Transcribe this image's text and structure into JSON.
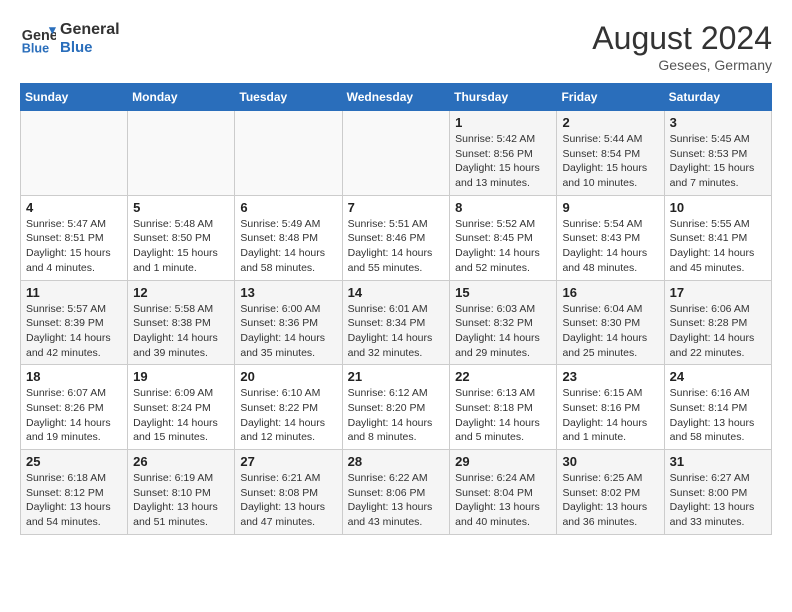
{
  "header": {
    "logo_line1": "General",
    "logo_line2": "Blue",
    "month": "August 2024",
    "location": "Gesees, Germany"
  },
  "days_of_week": [
    "Sunday",
    "Monday",
    "Tuesday",
    "Wednesday",
    "Thursday",
    "Friday",
    "Saturday"
  ],
  "weeks": [
    [
      {
        "day": "",
        "info": ""
      },
      {
        "day": "",
        "info": ""
      },
      {
        "day": "",
        "info": ""
      },
      {
        "day": "",
        "info": ""
      },
      {
        "day": "1",
        "info": "Sunrise: 5:42 AM\nSunset: 8:56 PM\nDaylight: 15 hours and 13 minutes."
      },
      {
        "day": "2",
        "info": "Sunrise: 5:44 AM\nSunset: 8:54 PM\nDaylight: 15 hours and 10 minutes."
      },
      {
        "day": "3",
        "info": "Sunrise: 5:45 AM\nSunset: 8:53 PM\nDaylight: 15 hours and 7 minutes."
      }
    ],
    [
      {
        "day": "4",
        "info": "Sunrise: 5:47 AM\nSunset: 8:51 PM\nDaylight: 15 hours and 4 minutes."
      },
      {
        "day": "5",
        "info": "Sunrise: 5:48 AM\nSunset: 8:50 PM\nDaylight: 15 hours and 1 minute."
      },
      {
        "day": "6",
        "info": "Sunrise: 5:49 AM\nSunset: 8:48 PM\nDaylight: 14 hours and 58 minutes."
      },
      {
        "day": "7",
        "info": "Sunrise: 5:51 AM\nSunset: 8:46 PM\nDaylight: 14 hours and 55 minutes."
      },
      {
        "day": "8",
        "info": "Sunrise: 5:52 AM\nSunset: 8:45 PM\nDaylight: 14 hours and 52 minutes."
      },
      {
        "day": "9",
        "info": "Sunrise: 5:54 AM\nSunset: 8:43 PM\nDaylight: 14 hours and 48 minutes."
      },
      {
        "day": "10",
        "info": "Sunrise: 5:55 AM\nSunset: 8:41 PM\nDaylight: 14 hours and 45 minutes."
      }
    ],
    [
      {
        "day": "11",
        "info": "Sunrise: 5:57 AM\nSunset: 8:39 PM\nDaylight: 14 hours and 42 minutes."
      },
      {
        "day": "12",
        "info": "Sunrise: 5:58 AM\nSunset: 8:38 PM\nDaylight: 14 hours and 39 minutes."
      },
      {
        "day": "13",
        "info": "Sunrise: 6:00 AM\nSunset: 8:36 PM\nDaylight: 14 hours and 35 minutes."
      },
      {
        "day": "14",
        "info": "Sunrise: 6:01 AM\nSunset: 8:34 PM\nDaylight: 14 hours and 32 minutes."
      },
      {
        "day": "15",
        "info": "Sunrise: 6:03 AM\nSunset: 8:32 PM\nDaylight: 14 hours and 29 minutes."
      },
      {
        "day": "16",
        "info": "Sunrise: 6:04 AM\nSunset: 8:30 PM\nDaylight: 14 hours and 25 minutes."
      },
      {
        "day": "17",
        "info": "Sunrise: 6:06 AM\nSunset: 8:28 PM\nDaylight: 14 hours and 22 minutes."
      }
    ],
    [
      {
        "day": "18",
        "info": "Sunrise: 6:07 AM\nSunset: 8:26 PM\nDaylight: 14 hours and 19 minutes."
      },
      {
        "day": "19",
        "info": "Sunrise: 6:09 AM\nSunset: 8:24 PM\nDaylight: 14 hours and 15 minutes."
      },
      {
        "day": "20",
        "info": "Sunrise: 6:10 AM\nSunset: 8:22 PM\nDaylight: 14 hours and 12 minutes."
      },
      {
        "day": "21",
        "info": "Sunrise: 6:12 AM\nSunset: 8:20 PM\nDaylight: 14 hours and 8 minutes."
      },
      {
        "day": "22",
        "info": "Sunrise: 6:13 AM\nSunset: 8:18 PM\nDaylight: 14 hours and 5 minutes."
      },
      {
        "day": "23",
        "info": "Sunrise: 6:15 AM\nSunset: 8:16 PM\nDaylight: 14 hours and 1 minute."
      },
      {
        "day": "24",
        "info": "Sunrise: 6:16 AM\nSunset: 8:14 PM\nDaylight: 13 hours and 58 minutes."
      }
    ],
    [
      {
        "day": "25",
        "info": "Sunrise: 6:18 AM\nSunset: 8:12 PM\nDaylight: 13 hours and 54 minutes."
      },
      {
        "day": "26",
        "info": "Sunrise: 6:19 AM\nSunset: 8:10 PM\nDaylight: 13 hours and 51 minutes."
      },
      {
        "day": "27",
        "info": "Sunrise: 6:21 AM\nSunset: 8:08 PM\nDaylight: 13 hours and 47 minutes."
      },
      {
        "day": "28",
        "info": "Sunrise: 6:22 AM\nSunset: 8:06 PM\nDaylight: 13 hours and 43 minutes."
      },
      {
        "day": "29",
        "info": "Sunrise: 6:24 AM\nSunset: 8:04 PM\nDaylight: 13 hours and 40 minutes."
      },
      {
        "day": "30",
        "info": "Sunrise: 6:25 AM\nSunset: 8:02 PM\nDaylight: 13 hours and 36 minutes."
      },
      {
        "day": "31",
        "info": "Sunrise: 6:27 AM\nSunset: 8:00 PM\nDaylight: 13 hours and 33 minutes."
      }
    ]
  ]
}
